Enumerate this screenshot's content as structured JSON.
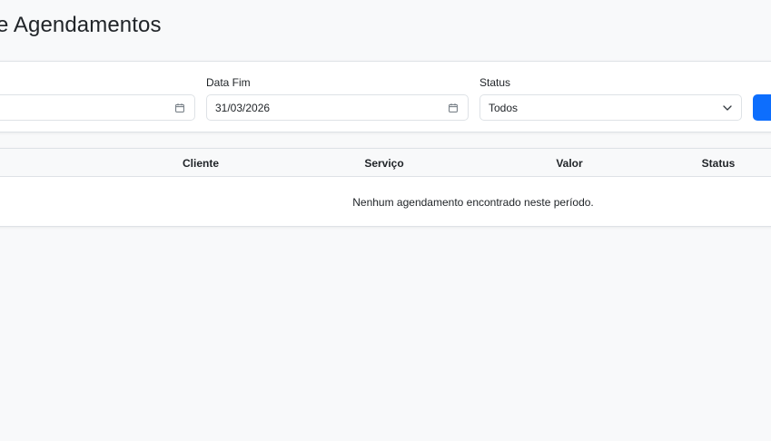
{
  "page": {
    "title": "e Agendamentos"
  },
  "filters": {
    "start_date_value": "",
    "end_date_label": "Data Fim",
    "end_date_value": "31/03/2026",
    "status_label": "Status",
    "status_value": "Todos"
  },
  "table": {
    "columns": [
      "Cliente",
      "Serviço",
      "Valor",
      "Status"
    ],
    "empty_message": "Nenhum agendamento encontrado neste período."
  },
  "colors": {
    "primary": "#0d6efd",
    "border": "#dee2e6",
    "background": "#f8f9fa"
  },
  "icons": [
    "calendar-icon",
    "chevron-down-icon"
  ]
}
